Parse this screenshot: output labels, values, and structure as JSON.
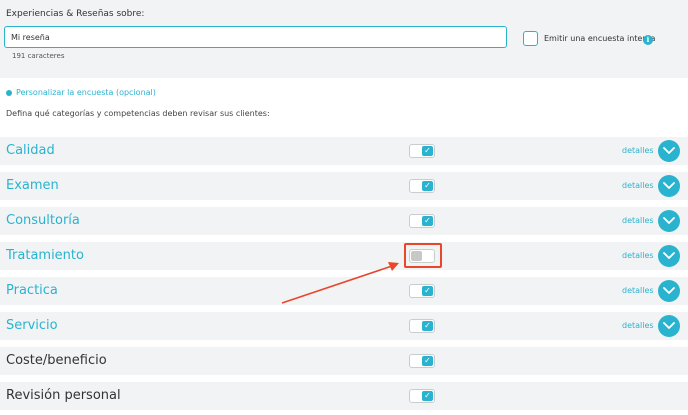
{
  "header": {
    "section_label": "Experiencias & Reseñas sobre:",
    "review_input_value": "Mi reseña",
    "char_count": "191 caracteres",
    "internal_survey_label": "Emitir una encuesta interna",
    "info_icon": "i"
  },
  "survey": {
    "customize_link": "Personalizar la encuesta (opcional)",
    "instructions": "Defina qué categorías y competencias deben revisar sus clientes:"
  },
  "categories": [
    {
      "label": "Calidad",
      "enabled": true,
      "details": "detalles"
    },
    {
      "label": "Examen",
      "enabled": true,
      "details": "detalles"
    },
    {
      "label": "Consultoría",
      "enabled": true,
      "details": "detalles"
    },
    {
      "label": "Tratamiento",
      "enabled": false,
      "details": "detalles"
    },
    {
      "label": "Practica",
      "enabled": true,
      "details": "detalles"
    },
    {
      "label": "Servicio",
      "enabled": true,
      "details": "detalles"
    },
    {
      "label": "Coste/beneficio",
      "enabled": true
    },
    {
      "label": "Revisión personal",
      "enabled": true
    }
  ],
  "toggle_check_glyph": "✓",
  "colors": {
    "accent": "#2ab3cf",
    "highlight": "#e8472a",
    "row_bg": "#f2f3f4"
  }
}
